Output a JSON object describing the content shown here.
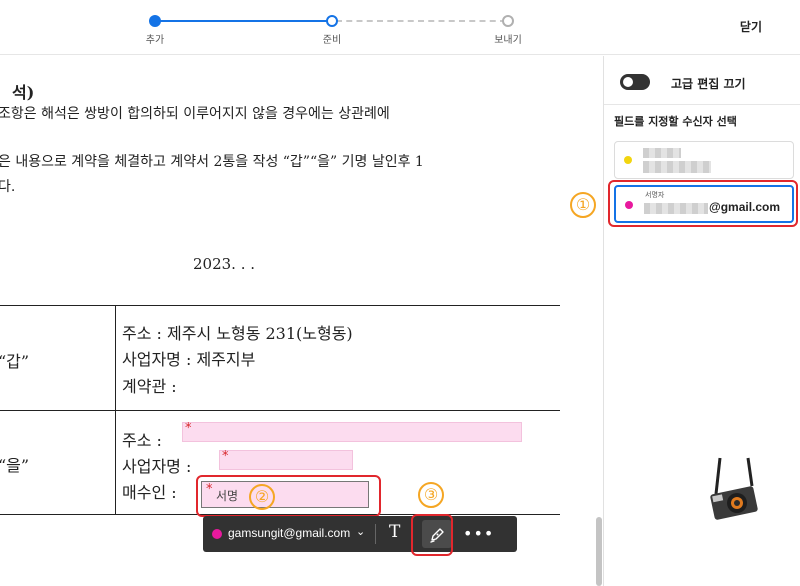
{
  "steps": [
    {
      "label": "추가",
      "state": "done"
    },
    {
      "label": "준비",
      "state": "current"
    },
    {
      "label": "보내기",
      "state": "next"
    }
  ],
  "close_label": "닫기",
  "document": {
    "heading": "석)",
    "line1": "조항은 해석은 쌍방이 합의하되 이루어지지 않을 경우에는 상관례에",
    "line2": "은 내용으로 계약을 체결하고 계약서 2통을 작성 “갑”“을” 기명 날인후 1",
    "line3": "다.",
    "date": "2023.   .    .",
    "party_a": {
      "label": "“갑”",
      "address": "주소 : 제주시 노형동 231(노형동)",
      "business": "사업자명 : 제주지부",
      "official": "계약관 :"
    },
    "party_b": {
      "label": "“을”",
      "address": "주소 :",
      "business": "사업자명 :",
      "buyer": "매수인 :"
    },
    "required_mark": "*",
    "signature_field_label": "서명"
  },
  "badges": [
    "①",
    "②",
    "③"
  ],
  "toolbar": {
    "recipient_email": "gamsungit@gmail.com",
    "chevron": "⌄",
    "text_tool": "T",
    "more": "•••"
  },
  "panel": {
    "advanced_edit_label": "고급 편집 끄기",
    "recipients_heading": "필드를 지정할 수신자 선택",
    "recipients": [
      {
        "role": "",
        "email": "",
        "color": "#f2d50f"
      },
      {
        "role": "서명자",
        "email": "@gmail.com",
        "color": "#e8199e"
      }
    ]
  },
  "colors": {
    "accent": "#1473e6",
    "highlight": "#e1272d",
    "badge": "#f5a623",
    "field_fill": "#fcdcef"
  }
}
